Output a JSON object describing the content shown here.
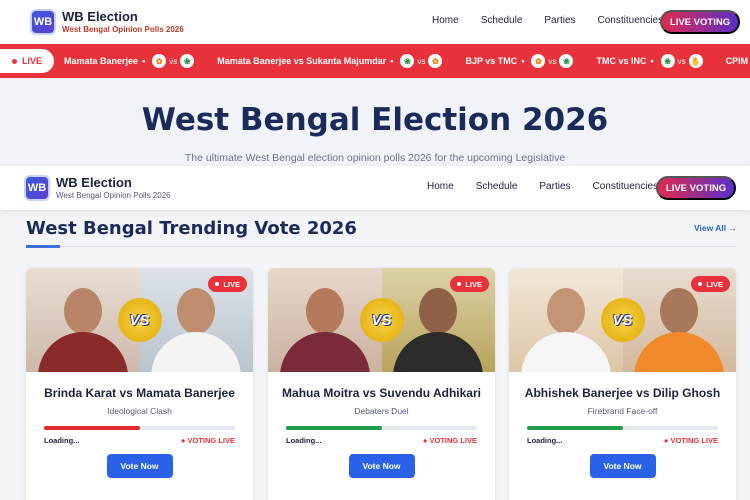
{
  "brand": {
    "logo": "WB",
    "title": "WB Election",
    "subtitle": "West Bengal Opinion Polls 2026"
  },
  "nav": {
    "links": [
      "Home",
      "Schedule",
      "Parties",
      "Constituencies"
    ],
    "live_button": "LIVE VOTING"
  },
  "ticker": {
    "live_label": "LIVE",
    "items": [
      {
        "text": "Mamata Banerjee",
        "icons": [
          "bjp-icon",
          "tmc-icon"
        ]
      },
      {
        "text": "Mamata Banerjee vs Sukanta Majumdar",
        "icons": [
          "tmc-icon",
          "bjp-icon"
        ]
      },
      {
        "text": "BJP vs TMC",
        "icons": [
          "bjp-icon",
          "tmc-icon"
        ]
      },
      {
        "text": "TMC vs INC",
        "icons": [
          "tmc-icon",
          "inc-icon"
        ]
      },
      {
        "text": "CPIM vs TMC",
        "icons": [
          "cpim-icon"
        ]
      }
    ],
    "vs": "vs"
  },
  "hero": {
    "title": "West Bengal Election 2026",
    "subtitle": "The ultimate West Bengal election opinion polls 2026 for the upcoming Legislative"
  },
  "section": {
    "title": "West Bengal Trending Vote 2026",
    "view_all": "View All →"
  },
  "cards": [
    {
      "title": "Brinda Karat vs Mamata Banerjee",
      "subtitle": "Ideological Clash",
      "progress": 0.5,
      "bar_color": "#e0282e",
      "loading": "Loading...",
      "status": "VOTING LIVE",
      "button": "Vote Now",
      "live": "LIVE",
      "vs": "VS"
    },
    {
      "title": "Mahua Moitra vs Suvendu Adhikari",
      "subtitle": "Debaters Duel",
      "progress": 0.5,
      "bar_color": "#1e9e4a",
      "loading": "Loading...",
      "status": "VOTING LIVE",
      "button": "Vote Now",
      "live": "LIVE",
      "vs": "VS"
    },
    {
      "title": "Abhishek Banerjee vs Dilip Ghosh",
      "subtitle": "Firebrand Face-off",
      "progress": 0.5,
      "bar_color": "#1e9e4a",
      "loading": "Loading...",
      "status": "VOTING LIVE",
      "button": "Vote Now",
      "live": "LIVE",
      "vs": "VS"
    }
  ],
  "colors": {
    "accent": "#2962e8",
    "ticker": "#e8313a",
    "heading": "#1b2a5a"
  }
}
